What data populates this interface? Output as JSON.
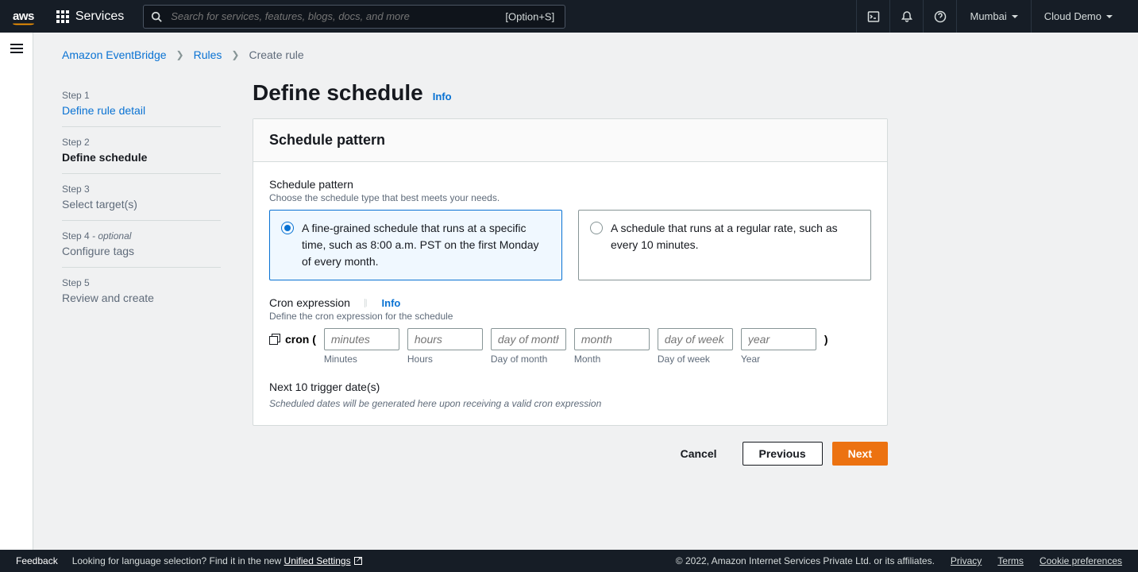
{
  "topnav": {
    "services_label": "Services",
    "search_placeholder": "Search for services, features, blogs, docs, and more",
    "search_hint": "[Option+S]",
    "region": "Mumbai",
    "account": "Cloud Demo"
  },
  "breadcrumbs": {
    "items": [
      "Amazon EventBridge",
      "Rules",
      "Create rule"
    ]
  },
  "steps": [
    {
      "num": "Step 1",
      "title": "Define rule detail",
      "state": "link"
    },
    {
      "num": "Step 2",
      "title": "Define schedule",
      "state": "current"
    },
    {
      "num": "Step 3",
      "title": "Select target(s)",
      "state": "future"
    },
    {
      "num": "Step 4",
      "optional": " - optional",
      "title": "Configure tags",
      "state": "future"
    },
    {
      "num": "Step 5",
      "title": "Review and create",
      "state": "future"
    }
  ],
  "page": {
    "title": "Define schedule",
    "info": "Info"
  },
  "card": {
    "header": "Schedule pattern",
    "pattern_label": "Schedule pattern",
    "pattern_desc": "Choose the schedule type that best meets your needs.",
    "options": [
      "A fine-grained schedule that runs at a specific time, such as 8:00 a.m. PST on the first Monday of every month.",
      "A schedule that runs at a regular rate, such as every 10 minutes."
    ],
    "selected_option": 0,
    "cron_label": "Cron expression",
    "cron_info": "Info",
    "cron_desc": "Define the cron expression for the schedule",
    "cron_prefix": "cron (",
    "cron_suffix": ")",
    "cron_fields": [
      {
        "placeholder": "minutes",
        "label": "Minutes"
      },
      {
        "placeholder": "hours",
        "label": "Hours"
      },
      {
        "placeholder": "day of month",
        "label": "Day of month"
      },
      {
        "placeholder": "month",
        "label": "Month"
      },
      {
        "placeholder": "day of week",
        "label": "Day of week"
      },
      {
        "placeholder": "year",
        "label": "Year"
      }
    ],
    "trigger_label": "Next 10 trigger date(s)",
    "trigger_note": "Scheduled dates will be generated here upon receiving a valid cron expression"
  },
  "actions": {
    "cancel": "Cancel",
    "previous": "Previous",
    "next": "Next"
  },
  "bottombar": {
    "feedback": "Feedback",
    "lang_prompt": "Looking for language selection? Find it in the new ",
    "unified": "Unified Settings",
    "copyright": "© 2022, Amazon Internet Services Private Ltd. or its affiliates.",
    "links": [
      "Privacy",
      "Terms",
      "Cookie preferences"
    ]
  }
}
